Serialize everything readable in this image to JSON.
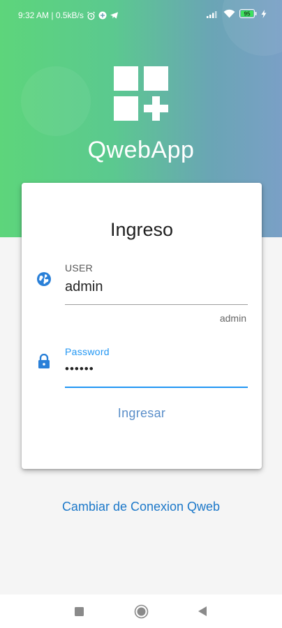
{
  "status_bar": {
    "time_and_speed": "9:32 AM | 0.5kB/s",
    "battery": "95",
    "icons": [
      "alarm-icon",
      "data-saver-icon",
      "telegram-icon",
      "signal-icon",
      "wifi-icon",
      "battery-icon",
      "charging-icon"
    ]
  },
  "app": {
    "name": "QwebApp",
    "logo_icon": "apps-add-icon"
  },
  "login": {
    "title": "Ingreso",
    "user_label": "USER",
    "user_value": "admin",
    "user_helper": "admin",
    "user_icon": "globe-icon",
    "password_label": "Password",
    "password_value": "••••••",
    "password_icon": "lock-icon",
    "submit_label": "Ingresar"
  },
  "footer": {
    "change_connection_label": "Cambiar de Conexion Qweb"
  },
  "nav": {
    "icons": [
      "recent-apps-icon",
      "home-icon",
      "back-icon"
    ]
  },
  "colors": {
    "accent": "#1c78c9",
    "focus_label": "#2196f3",
    "gradient_start": "#5dd57b",
    "gradient_end": "#7aa0c6"
  }
}
